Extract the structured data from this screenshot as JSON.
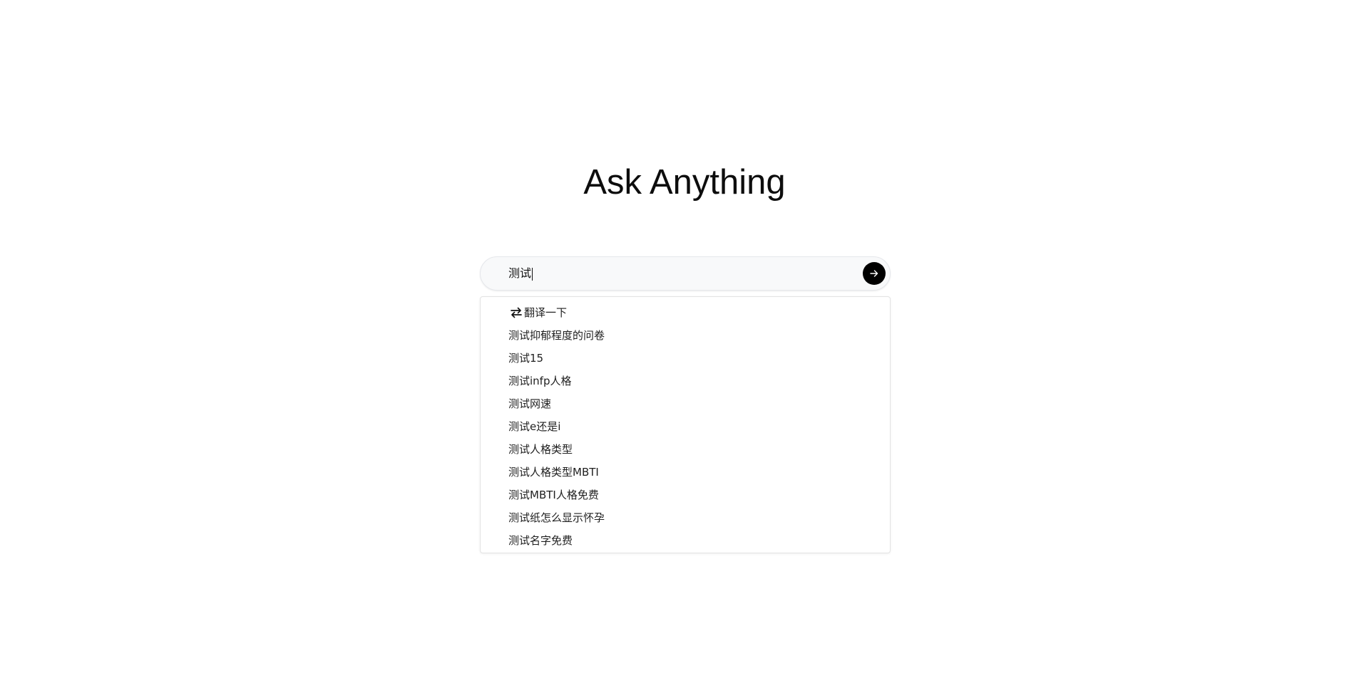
{
  "heading": "Ask Anything",
  "search": {
    "value": "测试",
    "submit_icon": "arrow-right-icon"
  },
  "suggestions": {
    "translate": {
      "icon": "swap-arrows-icon",
      "label": "翻译一下"
    },
    "items": [
      "测试抑郁程度的问卷",
      "测试15",
      "测试infp人格",
      "测试网速",
      "测试e还是i",
      "测试人格类型",
      "测试人格类型MBTI",
      "测试MBTI人格免费",
      "测试纸怎么显示怀孕",
      "测试名字免费"
    ]
  },
  "colors": {
    "accent": "#000000",
    "input_bg": "#f8f9fa"
  }
}
